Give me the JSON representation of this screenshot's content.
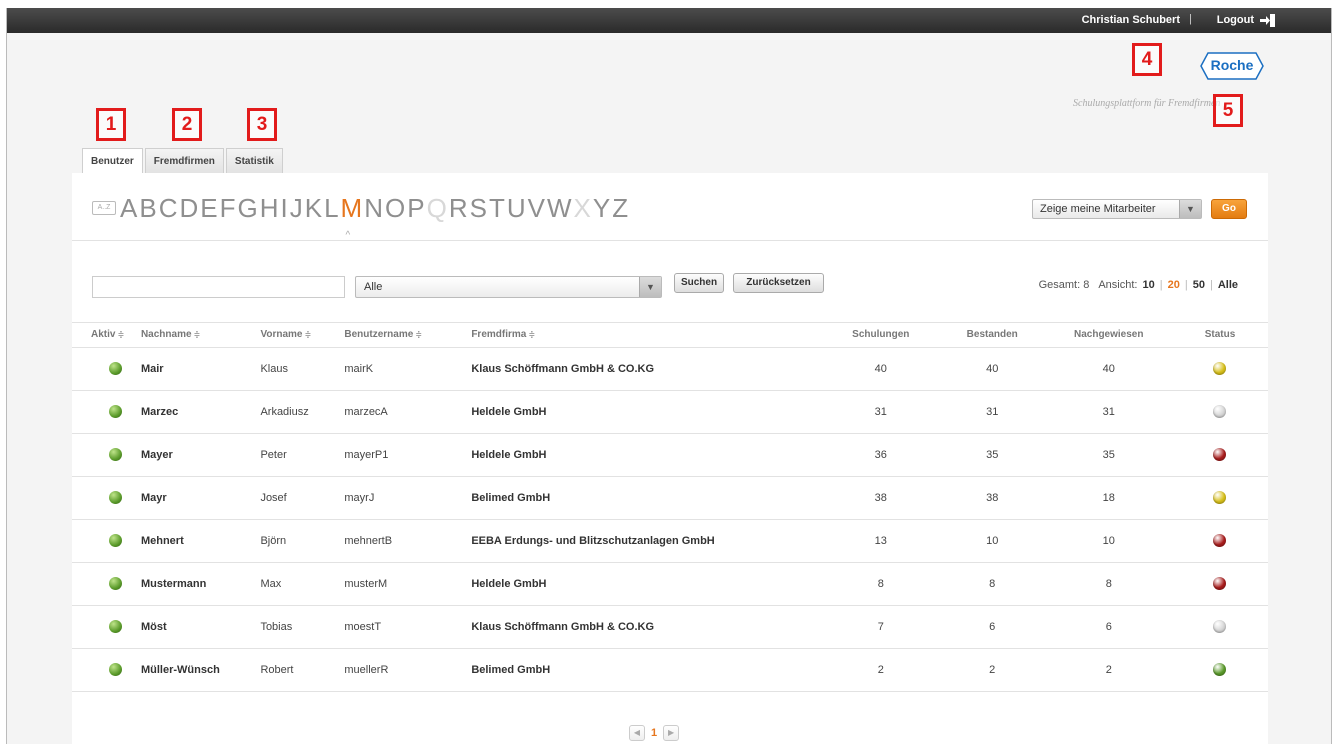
{
  "header": {
    "user_name": "Christian Schubert",
    "separator": "|",
    "logout_label": "Logout",
    "logo_text": "Roche",
    "tagline": "Schulungsplattform für Fremdfirmen"
  },
  "markers": [
    "1",
    "2",
    "3",
    "4",
    "5"
  ],
  "tabs": [
    {
      "label": "Benutzer",
      "active": true
    },
    {
      "label": "Fremdfirmen",
      "active": false
    },
    {
      "label": "Statistik",
      "active": false
    }
  ],
  "alphabet": {
    "icon_label": "A..Z",
    "letters": [
      "A",
      "B",
      "C",
      "D",
      "E",
      "F",
      "G",
      "H",
      "I",
      "J",
      "K",
      "L",
      "M",
      "N",
      "O",
      "P",
      "Q",
      "R",
      "S",
      "T",
      "U",
      "V",
      "W",
      "X",
      "Y",
      "Z"
    ],
    "active": "M",
    "disabled": [
      "Q",
      "X"
    ],
    "caret": "^"
  },
  "employee_filter": {
    "value": "Zeige meine Mitarbeiter",
    "arrow": "▼"
  },
  "go_label": "Go",
  "search": {
    "input_value": "",
    "company_value": "Alle",
    "company_arrow": "▼",
    "search_label": "Suchen",
    "reset_label": "Zurücksetzen"
  },
  "count_info": {
    "total_label": "Gesamt: 8",
    "view_label": "Ansicht:",
    "page_sizes": [
      "10",
      "20",
      "50",
      "Alle"
    ],
    "active_size": "20",
    "pipe": "|"
  },
  "table": {
    "sort_icon": "≑",
    "columns": [
      "Aktiv",
      "Nachname",
      "Vorname",
      "Benutzername",
      "Fremdfirma",
      "Schulungen",
      "Bestanden",
      "Nachgewiesen",
      "Status"
    ],
    "rows": [
      {
        "aktiv": "green",
        "nachname": "Mair",
        "vorname": "Klaus",
        "benutzer": "mairK",
        "firma": "Klaus Schöffmann GmbH & CO.KG",
        "schulungen": "40",
        "bestanden": "40",
        "nachgewiesen": "40",
        "status": "yellow"
      },
      {
        "aktiv": "green",
        "nachname": "Marzec",
        "vorname": "Arkadiusz",
        "benutzer": "marzecA",
        "firma": "Heldele GmbH",
        "schulungen": "31",
        "bestanden": "31",
        "nachgewiesen": "31",
        "status": "grey"
      },
      {
        "aktiv": "green",
        "nachname": "Mayer",
        "vorname": "Peter",
        "benutzer": "mayerP1",
        "firma": "Heldele GmbH",
        "schulungen": "36",
        "bestanden": "35",
        "nachgewiesen": "35",
        "status": "red"
      },
      {
        "aktiv": "green",
        "nachname": "Mayr",
        "vorname": "Josef",
        "benutzer": "mayrJ",
        "firma": "Belimed GmbH",
        "schulungen": "38",
        "bestanden": "38",
        "nachgewiesen": "18",
        "status": "yellow"
      },
      {
        "aktiv": "green",
        "nachname": "Mehnert",
        "vorname": "Björn",
        "benutzer": "mehnertB",
        "firma": "EEBA Erdungs- und Blitzschutzanlagen GmbH",
        "schulungen": "13",
        "bestanden": "10",
        "nachgewiesen": "10",
        "status": "red"
      },
      {
        "aktiv": "green",
        "nachname": "Mustermann",
        "vorname": "Max",
        "benutzer": "musterM",
        "firma": "Heldele GmbH",
        "schulungen": "8",
        "bestanden": "8",
        "nachgewiesen": "8",
        "status": "red"
      },
      {
        "aktiv": "green",
        "nachname": "Möst",
        "vorname": "Tobias",
        "benutzer": "moestT",
        "firma": "Klaus Schöffmann GmbH & CO.KG",
        "schulungen": "7",
        "bestanden": "6",
        "nachgewiesen": "6",
        "status": "grey"
      },
      {
        "aktiv": "green",
        "nachname": "Müller-Wünsch",
        "vorname": "Robert",
        "benutzer": "muellerR",
        "firma": "Belimed GmbH",
        "schulungen": "2",
        "bestanden": "2",
        "nachgewiesen": "2",
        "status": "green"
      }
    ]
  },
  "pager": {
    "prev": "◀",
    "current": "1",
    "next": "▶"
  },
  "colors": {
    "accent": "#e6761e",
    "marker": "#e21b1b",
    "green": "#5a9a2a",
    "yellow": "#d8c01a",
    "red": "#a81c1c",
    "grey": "#d6d6d6"
  }
}
